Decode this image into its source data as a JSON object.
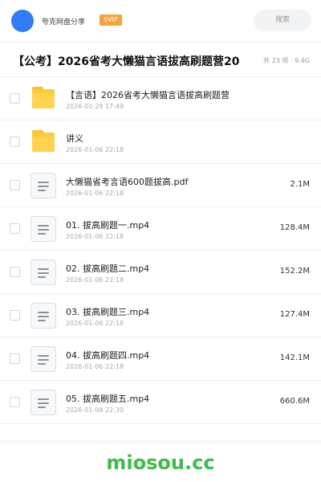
{
  "header": {
    "share_name": "夸克网盘分享",
    "badge": "SVIP",
    "search_label": "搜索",
    "avatar_color": "#2f7cf6"
  },
  "folder": {
    "title": "【公考】2026省考大懒猫言语拔高刷题营20",
    "meta": "共 23 项 · 9.4G"
  },
  "files": [
    {
      "type": "folder",
      "icon": "folder-icon",
      "name": "【言语】2026省考大懒猫言语拔高刷题营",
      "date": "2026-01-28 17:49",
      "size": ""
    },
    {
      "type": "folder",
      "icon": "folder-icon",
      "name": "讲义",
      "date": "2026-01-06 22:18",
      "size": ""
    },
    {
      "type": "file",
      "icon": "document-icon",
      "name": "大懒猫省考言语600题拔高.pdf",
      "date": "2026-01-06 22:18",
      "size": "2.1M"
    },
    {
      "type": "file",
      "icon": "document-icon",
      "name": "01. 拔高刷题一.mp4",
      "date": "2026-01-06 22:18",
      "size": "128.4M"
    },
    {
      "type": "file",
      "icon": "document-icon",
      "name": "02. 拔高刷题二.mp4",
      "date": "2026-01-06 22:18",
      "size": "152.2M"
    },
    {
      "type": "file",
      "icon": "document-icon",
      "name": "03. 拔高刷题三.mp4",
      "date": "2026-01-06 22:18",
      "size": "127.4M"
    },
    {
      "type": "file",
      "icon": "document-icon",
      "name": "04. 拔高刷题四.mp4",
      "date": "2026-01-06 22:18",
      "size": "142.1M"
    },
    {
      "type": "file",
      "icon": "document-icon",
      "name": "05. 拔高刷题五.mp4",
      "date": "2026-01-08 22:30",
      "size": "660.6M"
    }
  ],
  "watermark": "miosou.cc",
  "colors": {
    "accent": "#2f7cf6",
    "badge": "#f7a33a",
    "watermark": "#3dbb4b",
    "folder": "#ffd24f"
  }
}
